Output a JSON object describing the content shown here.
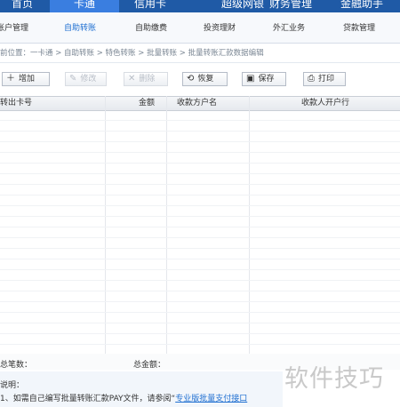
{
  "top_tabs": [
    {
      "label": "首页",
      "active": false
    },
    {
      "label": "卡通",
      "active": true
    },
    {
      "label": "信用卡",
      "active": false
    },
    {
      "label": "超级网银",
      "active": false
    },
    {
      "label": "财务管理",
      "active": false
    },
    {
      "label": "金融助手",
      "active": false
    }
  ],
  "sub_tabs": [
    {
      "label": "账户管理",
      "active": false
    },
    {
      "label": "自助转账",
      "active": true
    },
    {
      "label": "自助缴费",
      "active": false
    },
    {
      "label": "投资理财",
      "active": false
    },
    {
      "label": "外汇业务",
      "active": false
    },
    {
      "label": "贷款管理",
      "active": false
    }
  ],
  "breadcrumb": "前位置：一卡通 > 自助转账 > 特色转账 > 批量转账 > 批量转账汇款数据编辑",
  "toolbar": {
    "add": "增加",
    "edit": "修改",
    "delete": "删除",
    "restore": "恢复",
    "save": "保存",
    "print": "打印"
  },
  "table": {
    "headers": [
      "转出卡号",
      "金额",
      "收款方户名",
      "收款人开户行"
    ],
    "row_count": 23
  },
  "totals": {
    "count_label": "总笔数：",
    "amount_label": "总金额："
  },
  "note": {
    "title": "说明：",
    "text": "1、如需自己编写批量转账汇款PAY文件，请参阅“",
    "link": "专业版批量支付接口"
  },
  "watermark": "软件技巧",
  "colors": {
    "nav_bg": "#1f5aa6",
    "nav_active": "#3a7ee0",
    "link": "#1f6fd1"
  }
}
